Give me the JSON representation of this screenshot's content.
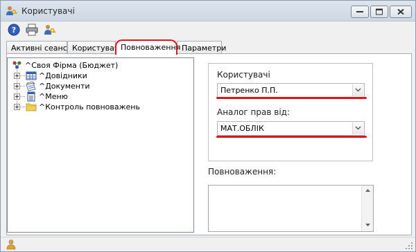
{
  "window": {
    "title": "Користувачі",
    "title_icon": "users-key-icon"
  },
  "toolbar": {
    "items": [
      {
        "icon": "help-icon"
      },
      {
        "icon": "printer-icon"
      },
      {
        "icon": "user-key-icon"
      }
    ]
  },
  "tabs": [
    {
      "label": "Активні сеанси",
      "active": false
    },
    {
      "label": "Користувачі",
      "active": false
    },
    {
      "label": "Повноваження",
      "active": true
    },
    {
      "label": "Параметри",
      "active": false
    }
  ],
  "tree": {
    "root": {
      "label": "^Своя Фірма (Бюджет)",
      "icon": "org-icon"
    },
    "children": [
      {
        "label": "^Довідники",
        "icon": "table-icon"
      },
      {
        "label": "^Документи",
        "icon": "document-icon"
      },
      {
        "label": "^Меню",
        "icon": "menu-icon"
      },
      {
        "label": "^Контроль повноважень",
        "icon": "folder-icon"
      }
    ]
  },
  "form": {
    "user_label": "Користувачі",
    "user_value": "Петренко П.П.",
    "analog_label": "Аналог прав від:",
    "analog_value": "МАТ.ОБЛІК",
    "permissions_label": "Повноваження:",
    "permissions_value": ""
  },
  "colors": {
    "highlight": "#e0151a"
  }
}
